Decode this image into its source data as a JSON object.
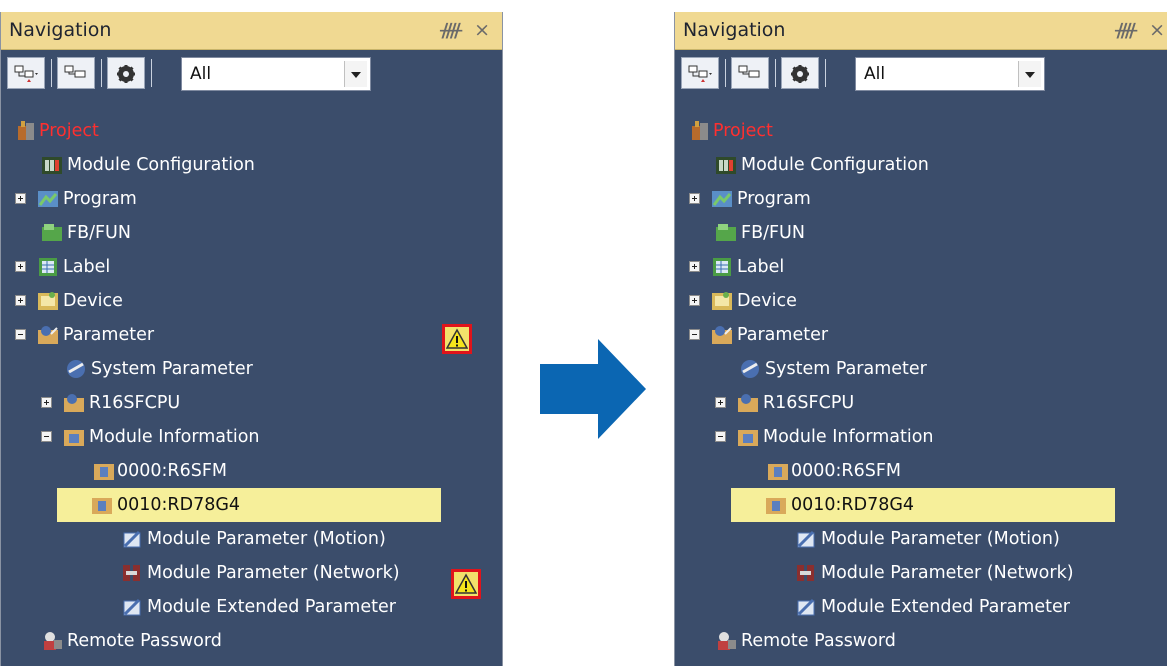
{
  "panels": [
    {
      "title": "Navigation",
      "filter": "All",
      "tree": [
        {
          "label": "Project"
        },
        {
          "label": "Module Configuration"
        },
        {
          "label": "Program"
        },
        {
          "label": "FB/FUN"
        },
        {
          "label": "Label"
        },
        {
          "label": "Device"
        },
        {
          "label": "Parameter"
        },
        {
          "label": "System Parameter"
        },
        {
          "label": "R16SFCPU"
        },
        {
          "label": "Module Information"
        },
        {
          "label": "0000:R6SFM"
        },
        {
          "label": "0010:RD78G4"
        },
        {
          "label": "Module Parameter (Motion)"
        },
        {
          "label": "Module Parameter (Network)"
        },
        {
          "label": "Module Extended Parameter"
        },
        {
          "label": "Remote Password"
        }
      ]
    },
    {
      "title": "Navigation",
      "filter": "All",
      "tree": [
        {
          "label": "Project"
        },
        {
          "label": "Module Configuration"
        },
        {
          "label": "Program"
        },
        {
          "label": "FB/FUN"
        },
        {
          "label": "Label"
        },
        {
          "label": "Device"
        },
        {
          "label": "Parameter"
        },
        {
          "label": "System Parameter"
        },
        {
          "label": "R16SFCPU"
        },
        {
          "label": "Module Information"
        },
        {
          "label": "0000:R6SFM"
        },
        {
          "label": "0010:RD78G4"
        },
        {
          "label": "Module Parameter (Motion)"
        },
        {
          "label": "Module Parameter (Network)"
        },
        {
          "label": "Module Extended Parameter"
        },
        {
          "label": "Remote Password"
        }
      ]
    }
  ],
  "colors": {
    "title_bg": "#f0d992",
    "tree_bg": "#3b4d6b",
    "highlight": "#f6ef9a",
    "project_text": "#ff2f2f",
    "warning_border": "#e0141b",
    "arrow": "#0b66b2"
  },
  "icons": {
    "pin": "pin-icon",
    "close": "close-icon",
    "warning": "warning-icon",
    "arrow": "right-arrow-icon"
  }
}
